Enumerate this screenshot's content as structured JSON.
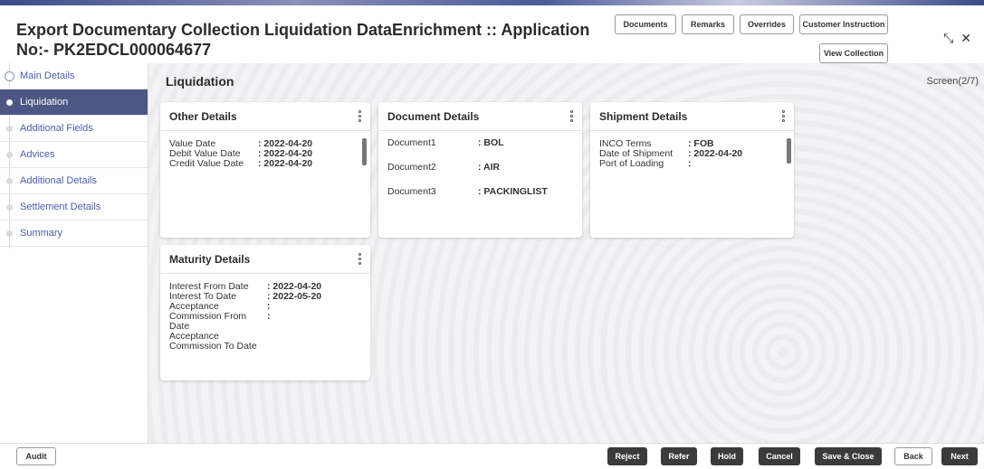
{
  "header": {
    "title": "Export Documentary Collection Liquidation DataEnrichment :: Application No:- PK2EDCL000064677",
    "buttons": {
      "documents": "Documents",
      "remarks": "Remarks",
      "overrides": "Overrides",
      "customer_instruction": "Customer Instruction",
      "view_collection": "View Collection"
    }
  },
  "sidebar": {
    "items": [
      {
        "label": "Main Details"
      },
      {
        "label": "Liquidation"
      },
      {
        "label": "Additional Fields"
      },
      {
        "label": "Advices"
      },
      {
        "label": "Additional Details"
      },
      {
        "label": "Settlement Details"
      },
      {
        "label": "Summary"
      }
    ]
  },
  "main": {
    "title": "Liquidation",
    "screen": "Screen(2/7)",
    "other_details": {
      "title": "Other Details",
      "rows": [
        {
          "label": "Value Date",
          "value": ": 2022-04-20"
        },
        {
          "label": "Debit Value Date",
          "value": ": 2022-04-20"
        },
        {
          "label": "Credit Value Date",
          "value": ": 2022-04-20"
        }
      ]
    },
    "document_details": {
      "title": "Document Details",
      "rows": [
        {
          "label": "Document1",
          "value": ": BOL"
        },
        {
          "label": "Document2",
          "value": ": AIR"
        },
        {
          "label": "Document3",
          "value": ": PACKINGLIST"
        }
      ]
    },
    "shipment_details": {
      "title": "Shipment Details",
      "rows": [
        {
          "label": "INCO Terms",
          "value": ": FOB"
        },
        {
          "label": "Date of Shipment",
          "value": ": 2022-04-20"
        },
        {
          "label": "Port of Loading",
          "value": ":"
        }
      ]
    },
    "maturity_details": {
      "title": "Maturity Details",
      "rows": [
        {
          "label": "Interest From Date",
          "value": ": 2022-04-20"
        },
        {
          "label": "Interest To Date",
          "value": ": 2022-05-20"
        },
        {
          "label": "Acceptance",
          "value": ":"
        },
        {
          "label": "Commission From",
          "value": ":"
        },
        {
          "label": "Date",
          "value": ""
        },
        {
          "label": "Acceptance",
          "value": ""
        },
        {
          "label": "Commission To Date",
          "value": ""
        }
      ]
    }
  },
  "footer": {
    "audit": "Audit",
    "reject": "Reject",
    "refer": "Refer",
    "hold": "Hold",
    "cancel": "Cancel",
    "save_close": "Save & Close",
    "back": "Back",
    "next": "Next"
  },
  "colors": {
    "sidebar_active": "#4d5684",
    "link": "#4a5da8",
    "dark_button": "#3b3b3b"
  }
}
